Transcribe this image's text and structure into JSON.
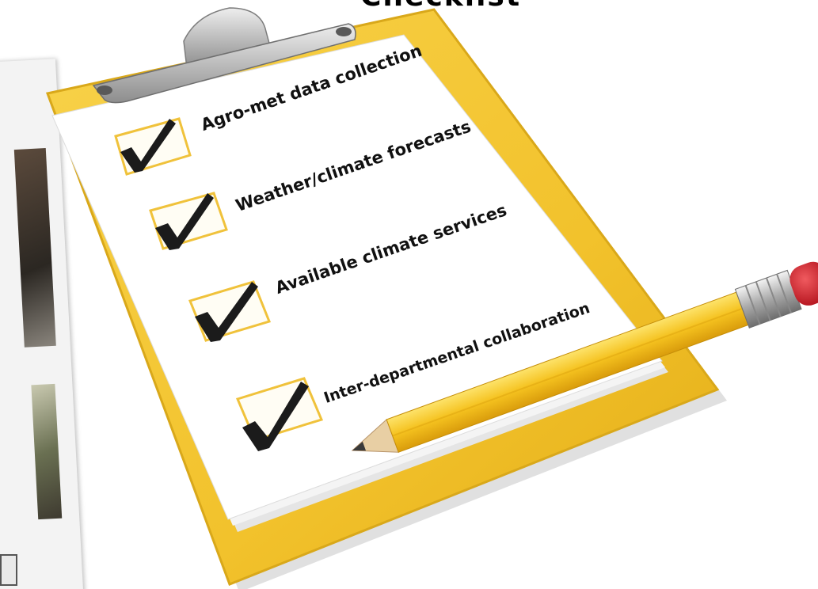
{
  "slide": {
    "title": "Checklist"
  },
  "checklist": {
    "items": [
      {
        "label": "Agro-met data collection",
        "checked": true
      },
      {
        "label": "Weather/climate forecasts",
        "checked": true
      },
      {
        "label": "Available climate services",
        "checked": true
      },
      {
        "label": "Inter-departmental collaboration",
        "checked": true
      }
    ]
  },
  "colors": {
    "clipboard": "#f2c430",
    "clipboard_edge": "#d9a81a",
    "paper": "#ffffff",
    "checkbox_border": "#f0c23b",
    "checkmark": "#1b1b1b",
    "pencil_body": "#f5c92a",
    "pencil_eraser": "#d11f2a",
    "clip_metal": "#c9c9c9"
  }
}
